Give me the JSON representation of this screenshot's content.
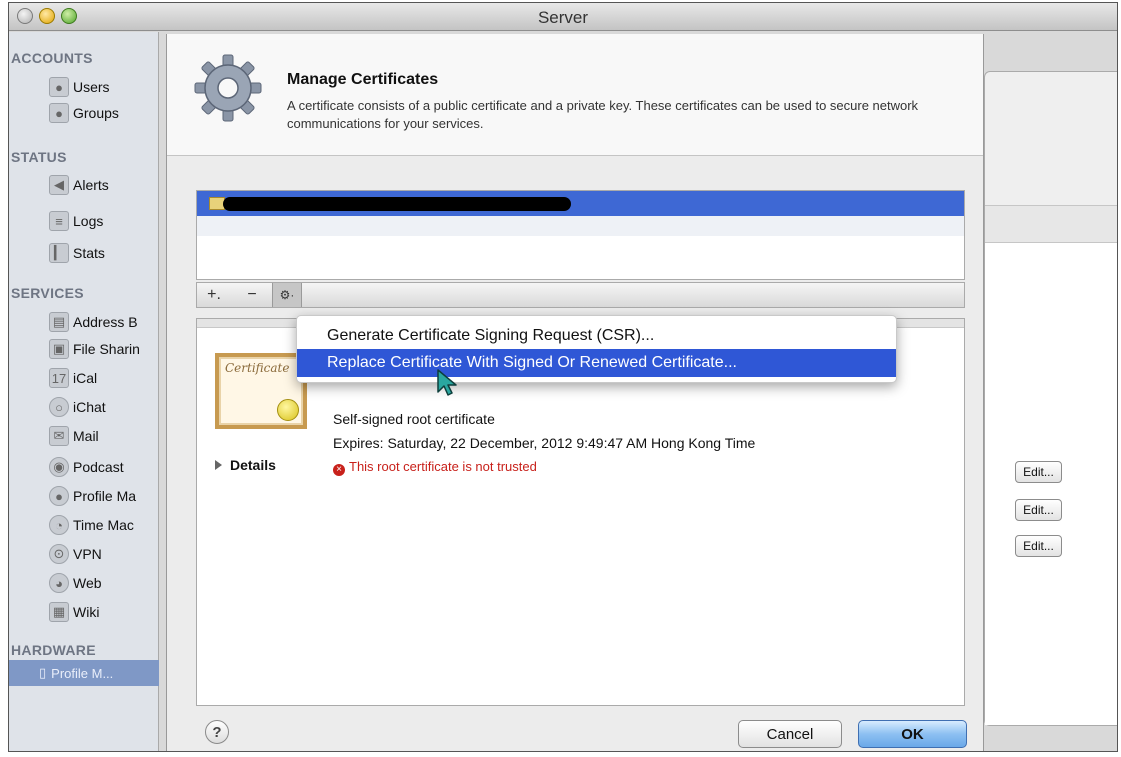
{
  "window": {
    "title": "Server"
  },
  "sidebar": {
    "sections": [
      {
        "label": "ACCOUNTS",
        "items": [
          {
            "label": "Users",
            "icon": "user-icon"
          },
          {
            "label": "Groups",
            "icon": "group-icon"
          }
        ]
      },
      {
        "label": "STATUS",
        "items": [
          {
            "label": "Alerts",
            "icon": "alert-icon"
          },
          {
            "label": "Logs",
            "icon": "log-icon"
          },
          {
            "label": "Stats",
            "icon": "stats-icon"
          }
        ]
      },
      {
        "label": "SERVICES",
        "items": [
          {
            "label": "Address B",
            "icon": "address-book-icon"
          },
          {
            "label": "File Sharin",
            "icon": "file-sharing-icon"
          },
          {
            "label": "iCal",
            "icon": "calendar-icon"
          },
          {
            "label": "iChat",
            "icon": "chat-icon"
          },
          {
            "label": "Mail",
            "icon": "mail-icon"
          },
          {
            "label": "Podcast",
            "icon": "podcast-icon"
          },
          {
            "label": "Profile Ma",
            "icon": "profile-manager-icon"
          },
          {
            "label": "Time Mac",
            "icon": "time-machine-icon"
          },
          {
            "label": "VPN",
            "icon": "vpn-icon"
          },
          {
            "label": "Web",
            "icon": "web-icon"
          },
          {
            "label": "Wiki",
            "icon": "wiki-icon"
          }
        ]
      },
      {
        "label": "HARDWARE",
        "items": [
          {
            "label": "Profile M...",
            "icon": "server-icon"
          }
        ]
      }
    ]
  },
  "background": {
    "edit_label": "Edit..."
  },
  "dialog": {
    "title": "Manage Certificates",
    "description": "A certificate consists of a public certificate and a private key. These certificates can be used to secure network communications for your services.",
    "toolbar": {
      "add": "+.",
      "remove": "−",
      "action": "⚙·"
    },
    "certificate": {
      "badge_text": "Certificate",
      "type": "Self-signed root certificate",
      "expires": "Expires: Saturday, 22 December, 2012 9:49:47 AM Hong Kong Time",
      "warning": "This root certificate is not trusted",
      "details_label": "Details"
    },
    "menu": {
      "items": [
        {
          "label": "Generate Certificate Signing Request (CSR)..."
        },
        {
          "label": "Replace Certificate With Signed Or Renewed Certificate..."
        }
      ],
      "highlight_color": "#2f57d6"
    },
    "buttons": {
      "help": "?",
      "cancel": "Cancel",
      "ok": "OK"
    },
    "selection_color": "#3e68d4"
  }
}
